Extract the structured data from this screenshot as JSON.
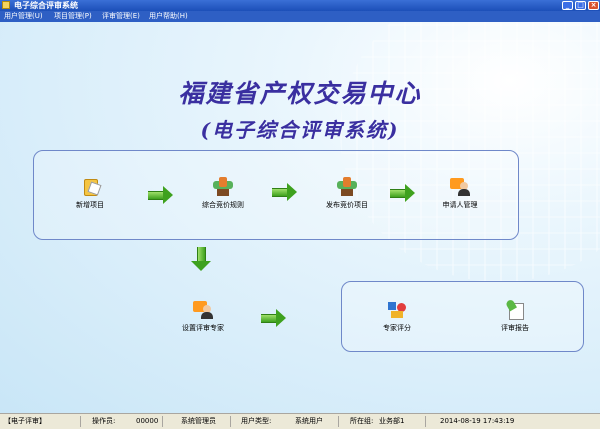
{
  "window": {
    "title": "电子综合评审系统",
    "minimize_glyph": "_",
    "restore_glyph": "□",
    "close_glyph": "×"
  },
  "menu": [
    {
      "label": "用户管理(U)"
    },
    {
      "label": "项目管理(P)"
    },
    {
      "label": "评审管理(E)"
    },
    {
      "label": "用户帮助(H)"
    }
  ],
  "heading": {
    "main": "福建省产权交易中心",
    "sub": "(电子综合评审系统)"
  },
  "workflow": {
    "top": [
      {
        "label": "新增项目",
        "icon": "new-project-icon"
      },
      {
        "label": "综合竞价规则",
        "icon": "bidding-rules-icon"
      },
      {
        "label": "发布竞价项目",
        "icon": "publish-project-icon"
      },
      {
        "label": "申请人管理",
        "icon": "applicant-icon"
      }
    ],
    "expert": {
      "label": "设置评审专家",
      "icon": "set-expert-icon"
    },
    "bottom": [
      {
        "label": "专家评分",
        "icon": "expert-score-icon"
      },
      {
        "label": "评审报告",
        "icon": "review-report-icon"
      }
    ]
  },
  "status": {
    "app": "【电子评审】",
    "operator_label": "操作员:",
    "operator_id": "00000",
    "operator_name": "系统管理员",
    "user_type_label": "用户类型:",
    "user_type": "系统用户",
    "location_label": "所在组:",
    "location": "业务部1",
    "datetime": "2014-08-19 17:43:19"
  },
  "colors": {
    "titlebar": "#1c4fb8",
    "menubar": "#2e5fc4",
    "heading": "#3a2fa0",
    "panel_border": "#6f88c9",
    "arrow": "#3ea11e"
  }
}
